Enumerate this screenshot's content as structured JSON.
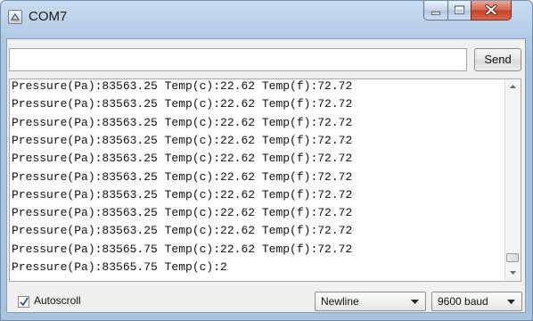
{
  "window": {
    "title": "COM7"
  },
  "send": {
    "input_value": "",
    "button_label": "Send"
  },
  "output": {
    "lines": [
      "Pressure(Pa):83563.25 Temp(c):22.62 Temp(f):72.72",
      "Pressure(Pa):83563.25 Temp(c):22.62 Temp(f):72.72",
      "Pressure(Pa):83563.25 Temp(c):22.62 Temp(f):72.72",
      "Pressure(Pa):83563.25 Temp(c):22.62 Temp(f):72.72",
      "Pressure(Pa):83563.25 Temp(c):22.62 Temp(f):72.72",
      "Pressure(Pa):83563.25 Temp(c):22.62 Temp(f):72.72",
      "Pressure(Pa):83563.25 Temp(c):22.62 Temp(f):72.72",
      "Pressure(Pa):83563.25 Temp(c):22.62 Temp(f):72.72",
      "Pressure(Pa):83563.25 Temp(c):22.62 Temp(f):72.72",
      "Pressure(Pa):83565.75 Temp(c):22.62 Temp(f):72.72",
      "Pressure(Pa):83565.75 Temp(c):2"
    ]
  },
  "footer": {
    "autoscroll_label": "Autoscroll",
    "autoscroll_checked": true,
    "line_ending_selected": "Newline",
    "baud_selected": "9600 baud"
  },
  "icons": {
    "app": "serial-monitor-icon",
    "minimize": "minimize-icon",
    "maximize": "maximize-icon",
    "close": "close-icon",
    "scroll_up": "scroll-up-arrow-icon",
    "scroll_down": "scroll-down-arrow-icon",
    "dropdown": "chevron-down-icon",
    "check": "checkmark-icon"
  },
  "colors": {
    "title_bar": "#b5cde6",
    "close_button": "#c43f25",
    "client_bg": "#f0f0f0"
  }
}
